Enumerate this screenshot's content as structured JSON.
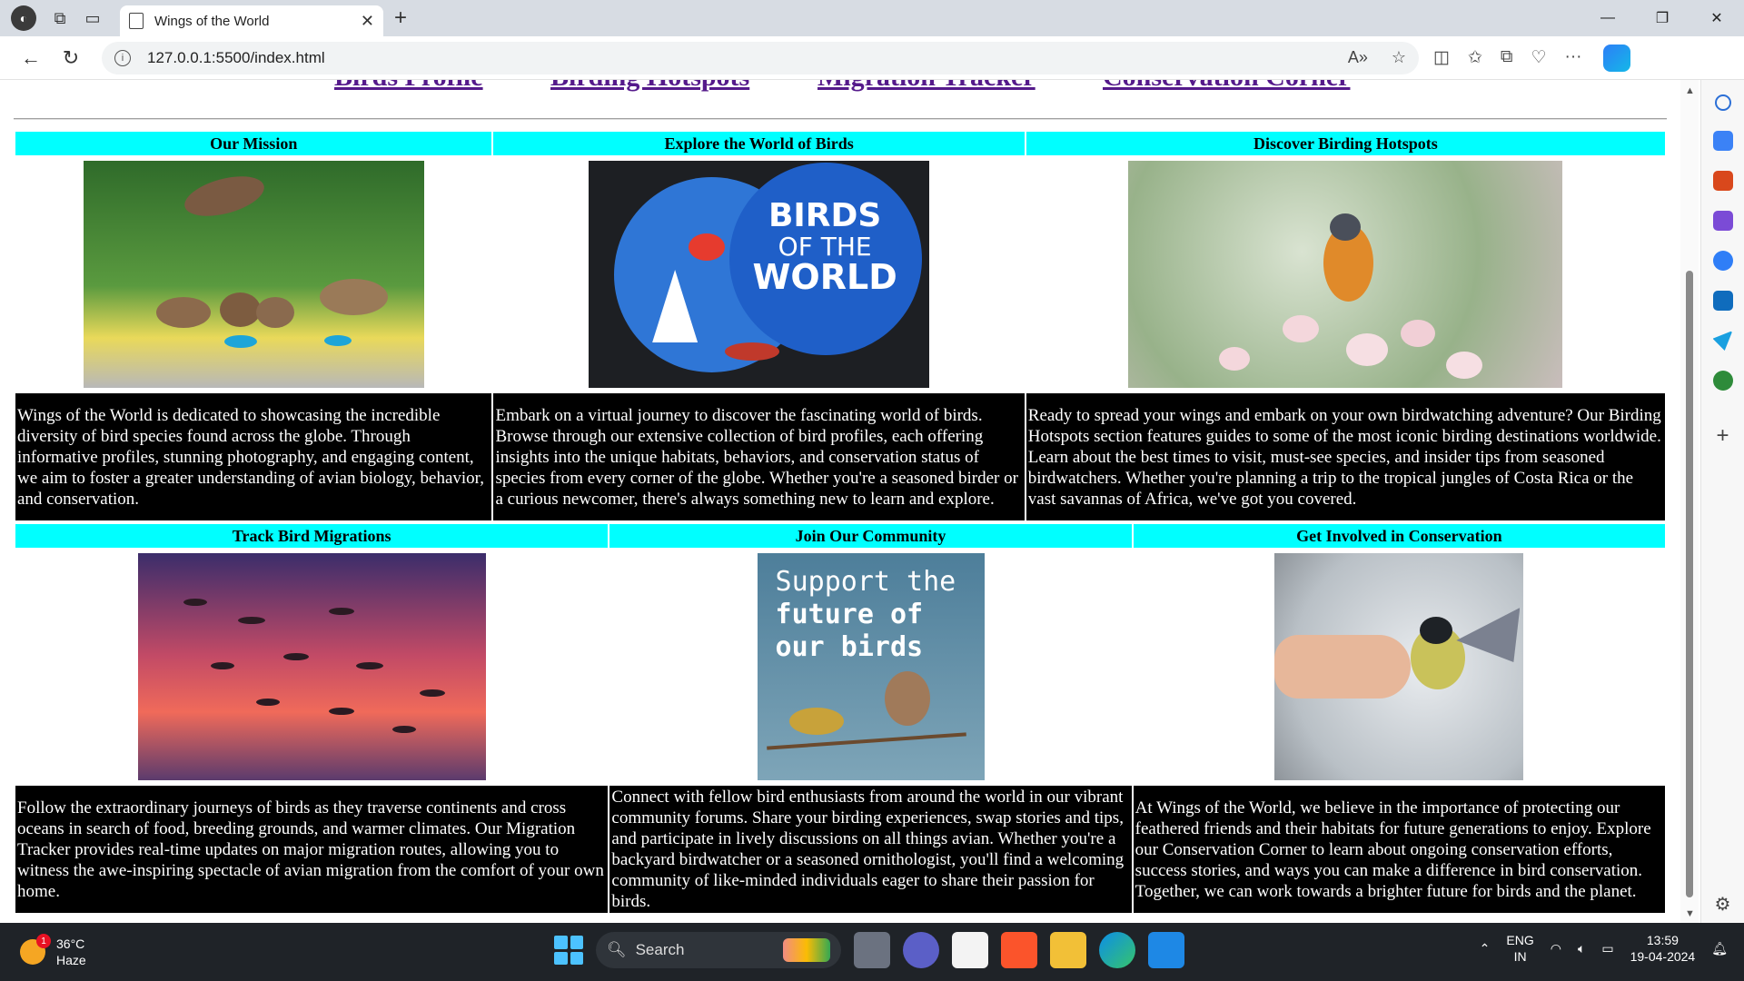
{
  "browser": {
    "tab_title": "Wings of the World",
    "url": "127.0.0.1:5500/index.html",
    "new_tab": "+",
    "minimize": "—",
    "restore": "❐",
    "close": "✕"
  },
  "nav": {
    "links": [
      "Birds Profile",
      "Birding Hotspots",
      "Migration Tracker",
      "Conservation Corner"
    ]
  },
  "sections_row1": [
    {
      "heading": "Our Mission",
      "text": "Wings of the World is dedicated to showcasing the incredible diversity of bird species found across the globe. Through informative profiles, stunning photography, and engaging content, we aim to foster a greater understanding of avian biology, behavior, and conservation."
    },
    {
      "heading": "Explore the World of Birds",
      "image_text": [
        "BIRDS",
        "OF THE",
        "WORLD"
      ],
      "text": "Embark on a virtual journey to discover the fascinating world of birds. Browse through our extensive collection of bird profiles, each offering insights into the unique habitats, behaviors, and conservation status of species from every corner of the globe. Whether you're a seasoned birder or a curious newcomer, there's always something new to learn and explore."
    },
    {
      "heading": "Discover Birding Hotspots",
      "text": "Ready to spread your wings and embark on your own birdwatching adventure? Our Birding Hotspots section features guides to some of the most iconic birding destinations worldwide. Learn about the best times to visit, must-see species, and insider tips from seasoned birdwatchers. Whether you're planning a trip to the tropical jungles of Costa Rica or the vast savannas of Africa, we've got you covered."
    }
  ],
  "sections_row2": [
    {
      "heading": "Track Bird Migrations",
      "text": "Follow the extraordinary journeys of birds as they traverse continents and cross oceans in search of food, breeding grounds, and warmer climates. Our Migration Tracker provides real-time updates on major migration routes, allowing you to witness the awe-inspiring spectacle of avian migration from the comfort of your own home."
    },
    {
      "heading": "Join Our Community",
      "image_text": [
        "Support the",
        "future of",
        "our birds"
      ],
      "text": "Connect with fellow bird enthusiasts from around the world in our vibrant community forums. Share your birding experiences, swap stories and tips, and participate in lively discussions on all things avian. Whether you're a backyard birdwatcher or a seasoned ornithologist, you'll find a welcoming community of like-minded individuals eager to share their passion for birds."
    },
    {
      "heading": "Get Involved in Conservation",
      "text": "At Wings of the World, we believe in the importance of protecting our feathered friends and their habitats for future generations to enjoy. Explore our Conservation Corner to learn about ongoing conservation efforts, success stories, and ways you can make a difference in bird conservation. Together, we can work towards a brighter future for birds and the planet."
    }
  ],
  "taskbar": {
    "weather_temp": "36°C",
    "weather_desc": "Haze",
    "weather_badge": "1",
    "search_placeholder": "Search",
    "lang_top": "ENG",
    "lang_bottom": "IN",
    "time": "13:59",
    "date": "19-04-2024"
  },
  "colors": {
    "heading_bg": "#00ffff",
    "text_bg": "#000000",
    "link": "#551a8b"
  }
}
